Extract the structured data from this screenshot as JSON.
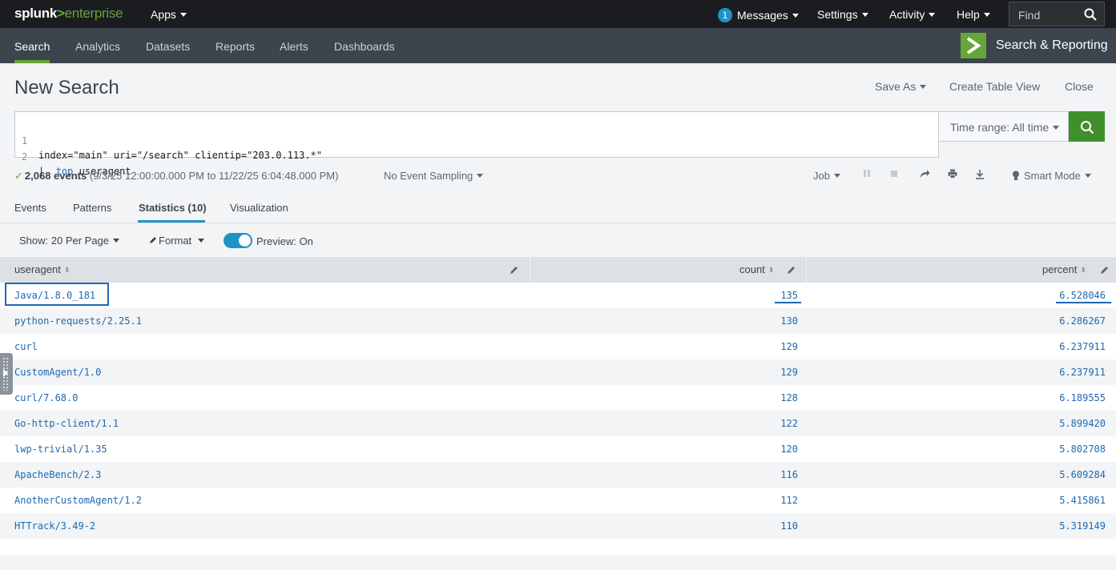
{
  "topbar": {
    "logo": {
      "brand": "splunk",
      "separator": ">",
      "product": "enterprise"
    },
    "apps_label": "Apps",
    "messages_count": "1",
    "messages_label": "Messages",
    "settings_label": "Settings",
    "activity_label": "Activity",
    "help_label": "Help",
    "find_placeholder": "Find"
  },
  "appbar": {
    "tabs": [
      {
        "label": "Search"
      },
      {
        "label": "Analytics"
      },
      {
        "label": "Datasets"
      },
      {
        "label": "Reports"
      },
      {
        "label": "Alerts"
      },
      {
        "label": "Dashboards"
      }
    ],
    "active_tab": "Search",
    "app_title": "Search & Reporting"
  },
  "page": {
    "title": "New Search",
    "save_as": "Save As",
    "create_table_view": "Create Table View",
    "close": "Close"
  },
  "search": {
    "lines": [
      {
        "num": "1",
        "text": "index=\"main\" uri=\"/search\" clientip=\"203.0.113.*\""
      },
      {
        "num": "2",
        "pipe": "|  ",
        "keyword": "top",
        "arg": " useragent"
      }
    ],
    "time_range": "Time range: All time"
  },
  "status": {
    "check": "✓",
    "events": "2,068 events",
    "range": "(9/3/25 12:00:00.000 PM to 11/22/25 6:04:48.000 PM)",
    "sampling": "No Event Sampling",
    "job": "Job",
    "smart_mode": "Smart Mode"
  },
  "result_tabs": [
    {
      "label": "Events"
    },
    {
      "label": "Patterns"
    },
    {
      "label": "Statistics (10)"
    },
    {
      "label": "Visualization"
    }
  ],
  "options": {
    "per_page": "Show: 20 Per Page",
    "format": "Format",
    "preview": "Preview: On"
  },
  "table": {
    "columns": [
      "useragent",
      "count",
      "percent"
    ],
    "rows": [
      {
        "useragent": "Java/1.8.0_181",
        "count": "135",
        "percent": "6.528046"
      },
      {
        "useragent": "python-requests/2.25.1",
        "count": "130",
        "percent": "6.286267"
      },
      {
        "useragent": "curl",
        "count": "129",
        "percent": "6.237911"
      },
      {
        "useragent": "CustomAgent/1.0",
        "count": "129",
        "percent": "6.237911"
      },
      {
        "useragent": "curl/7.68.0",
        "count": "128",
        "percent": "6.189555"
      },
      {
        "useragent": "Go-http-client/1.1",
        "count": "122",
        "percent": "5.899420"
      },
      {
        "useragent": "lwp-trivial/1.35",
        "count": "120",
        "percent": "5.802708"
      },
      {
        "useragent": "ApacheBench/2.3",
        "count": "116",
        "percent": "5.609284"
      },
      {
        "useragent": "AnotherCustomAgent/1.2",
        "count": "112",
        "percent": "5.415861"
      },
      {
        "useragent": "HTTrack/3.49-2",
        "count": "110",
        "percent": "5.319149"
      }
    ]
  },
  "colors": {
    "accent_green": "#65a637",
    "link_blue": "#1e68b3",
    "toggle_blue": "#1e93c6",
    "topbar_bg": "#1a1c20",
    "appbar_bg": "#3c444d"
  }
}
